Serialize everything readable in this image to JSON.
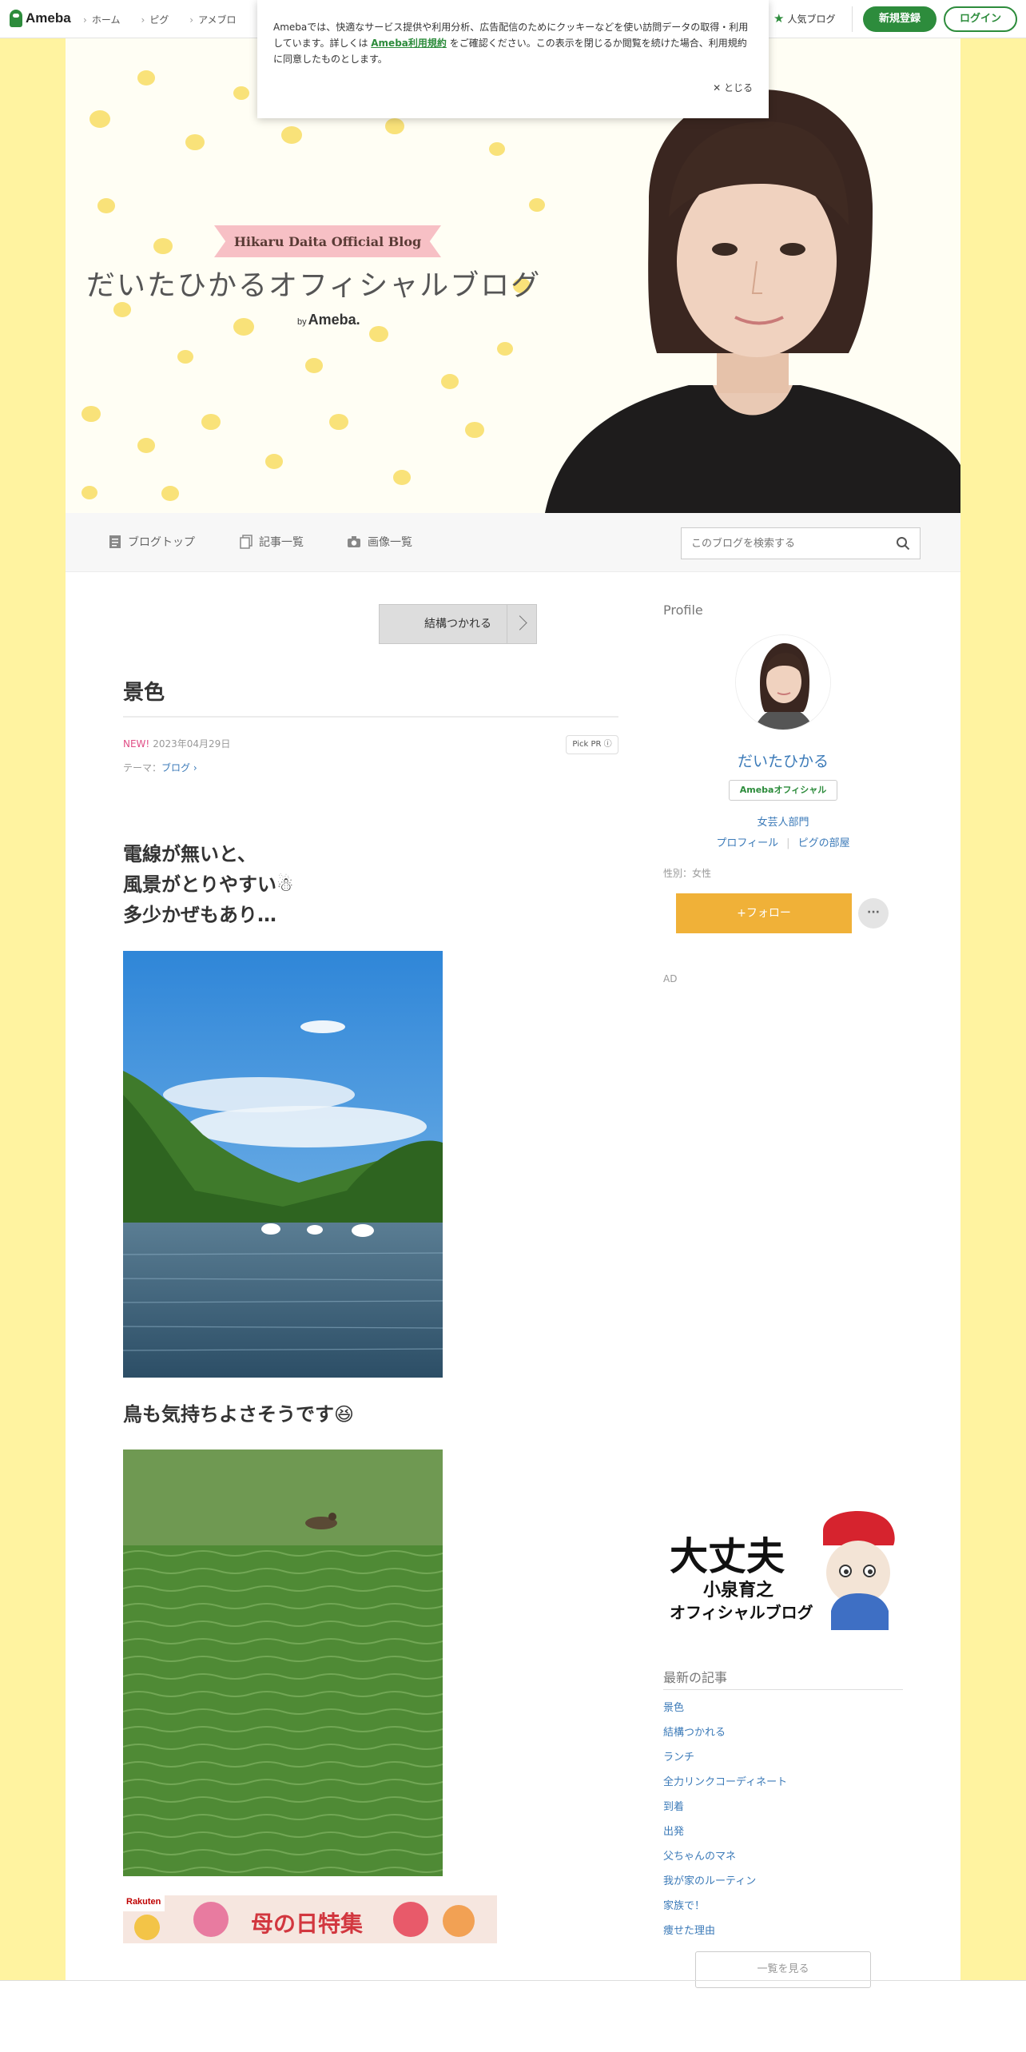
{
  "topbar": {
    "logo": "Ameba",
    "nav": [
      "ホーム",
      "ピグ",
      "アメブロ"
    ],
    "popular": "人気ブログ",
    "signup": "新規登録",
    "login": "ログイン"
  },
  "cookie": {
    "text_before": "Amebaでは、快適なサービス提供や利用分析、広告配信のためにクッキーなどを使い訪問データの取得・利用しています。詳しくは ",
    "link": "Ameba利用規約",
    "text_after": " をご確認ください。この表示を閉じるか閲覧を続けた場合、利用規約に同意したものとします。",
    "close": "とじる"
  },
  "header": {
    "ribbon": "Hikaru Daita Official Blog",
    "title": "だいたひかるオフィシャルブログ",
    "by": "by",
    "by_brand": "Ameba."
  },
  "blognav": {
    "items": [
      "ブログトップ",
      "記事一覧",
      "画像一覧"
    ],
    "search_placeholder": "このブログを検索する"
  },
  "article": {
    "prev": "結構つかれる",
    "title": "景色",
    "new_label": "NEW!",
    "date": "2023年04月29日",
    "pickpr": "Pick PR ⓘ",
    "theme_label": "テーマ：",
    "theme": "ブログ ›",
    "lines": [
      "電線が無いと、",
      "風景がとりやすい☃",
      "多少かぜもあり…"
    ],
    "caption2": "鳥も気持ちよさそうです😆",
    "banner_brand": "Rakuten",
    "banner_text": "母の日特集"
  },
  "sidebar": {
    "heading": "Profile",
    "name": "だいたひかる",
    "official": "Amebaオフィシャル",
    "dept": "女芸人部門",
    "link_profile": "プロフィール",
    "link_pig": "ピグの部屋",
    "gender": "性別：女性",
    "follow": "+フォロー",
    "more": "···",
    "ad": "AD",
    "banner_big": "大丈夫",
    "banner_sub1": "小泉育之",
    "banner_sub2": "オフィシャルブログ",
    "latest_heading": "最新の記事",
    "latest": [
      "景色",
      "結構つかれる",
      "ランチ",
      "全力リンクコーディネート",
      "到着",
      "出発",
      "父ちゃんのマネ",
      "我が家のルーティン",
      "家族で！",
      "痩せた理由"
    ],
    "see_all": "一覧を見る"
  },
  "colors": {
    "brand_green": "#2d8c3c",
    "side_yellow": "#fff3a0",
    "follow_orange": "#f0b138",
    "link_blue": "#3b7ab8",
    "new_pink": "#e04e86"
  }
}
